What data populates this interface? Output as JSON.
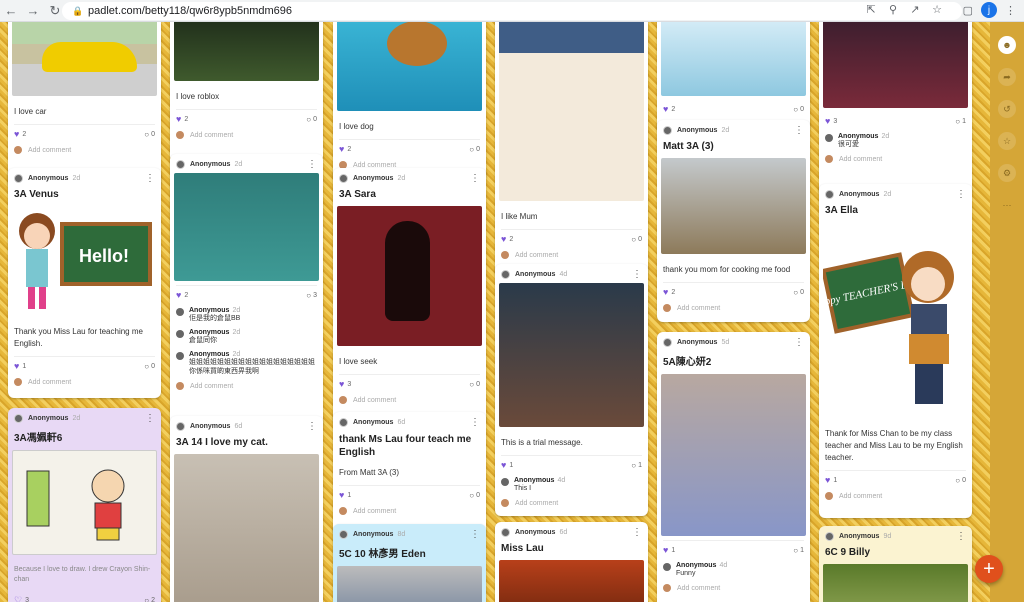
{
  "browser": {
    "url": "padlet.com/betty118/qw6r8ypb5nmdm696",
    "profile_initial": "j"
  },
  "icons": {
    "back": "arrow-left-icon",
    "forward": "arrow-right-icon",
    "reload": "reload-icon",
    "lock": "lock-icon",
    "like": "heart-icon",
    "comment": "comment-bubble-icon",
    "more": "more-vertical-icon",
    "fab": "plus-icon"
  },
  "colors": {
    "board": "#e6b73a",
    "heart": "#7b55d6",
    "fab": "#e0501c"
  },
  "author": "Anonymous",
  "add_comment": "Add comment",
  "cards": {
    "c1a": {
      "body": "I love car",
      "likes": "2",
      "comments": "0"
    },
    "c1b": {
      "time": "2d",
      "title": "3A Venus",
      "body": "Thank you Miss Lau for teaching me English.",
      "likes": "1",
      "comments": "0",
      "image_text": "Hello!"
    },
    "c1c": {
      "time": "2d",
      "title": "3A馮姵軒6",
      "body": "Because I love to draw.  I drew Crayon Shin-chan",
      "likes": "3",
      "comments": "2"
    },
    "c2a": {
      "body": "I love roblox",
      "likes": "2",
      "comments": "0"
    },
    "c2b": {
      "time": "2d",
      "likes": "2",
      "comments": "3",
      "comments_list": [
        {
          "time": "2d",
          "text": "佢是我的倉鼠BB"
        },
        {
          "time": "2d",
          "text": "倉鼠同你"
        },
        {
          "time": "2d",
          "text": "姐姐姐姐姐姐姐姐姐姐姐姐姐姐姐姐姐姐你係咪買啲東西畀我啊"
        }
      ]
    },
    "c2c": {
      "time": "6d",
      "title": "3A 14 I love my cat."
    },
    "c3a": {
      "body": "I love dog",
      "likes": "2",
      "comments": "0"
    },
    "c3b": {
      "time": "2d",
      "title": "3A Sara",
      "body": "I love seek",
      "likes": "3",
      "comments": "0"
    },
    "c3c": {
      "time": "6d",
      "title": "thank Ms Lau four teach me English",
      "body": "From Matt 3A (3)",
      "likes": "1",
      "comments": "0"
    },
    "c3d": {
      "time": "8d",
      "title": "5C 10 林彥男 Eden"
    },
    "c4a": {
      "body": "I like Mum",
      "likes": "2",
      "comments": "0"
    },
    "c4b": {
      "time": "4d",
      "body": "This is a trial message.",
      "likes": "1",
      "comments": "1",
      "comment": {
        "time": "4d",
        "text": "This I"
      }
    },
    "c4c": {
      "time": "6d",
      "title": "Miss Lau"
    },
    "c5a": {
      "likes": "2",
      "comments": "0"
    },
    "c5b": {
      "time": "2d",
      "title": "Matt 3A (3)",
      "body": "thank you mom for cooking me  food",
      "likes": "2",
      "comments": "0"
    },
    "c5c": {
      "time": "5d",
      "title": "5A陳心妍2",
      "likes": "1",
      "comments": "1",
      "comment": {
        "time": "4d",
        "text": "Funny"
      }
    },
    "c6a": {
      "likes": "3",
      "comments": "1",
      "comment": {
        "time": "2d",
        "text": "很可愛"
      }
    },
    "c6b": {
      "time": "2d",
      "title": "3A Ella",
      "body": "Thank for Miss Chan to be my class teacher and Miss Lau to be my English teacher.",
      "likes": "1",
      "comments": "0",
      "image_text": "Happy TEACHER'S Day"
    },
    "c6c": {
      "time": "9d",
      "title": "6C 9 Billy"
    }
  }
}
